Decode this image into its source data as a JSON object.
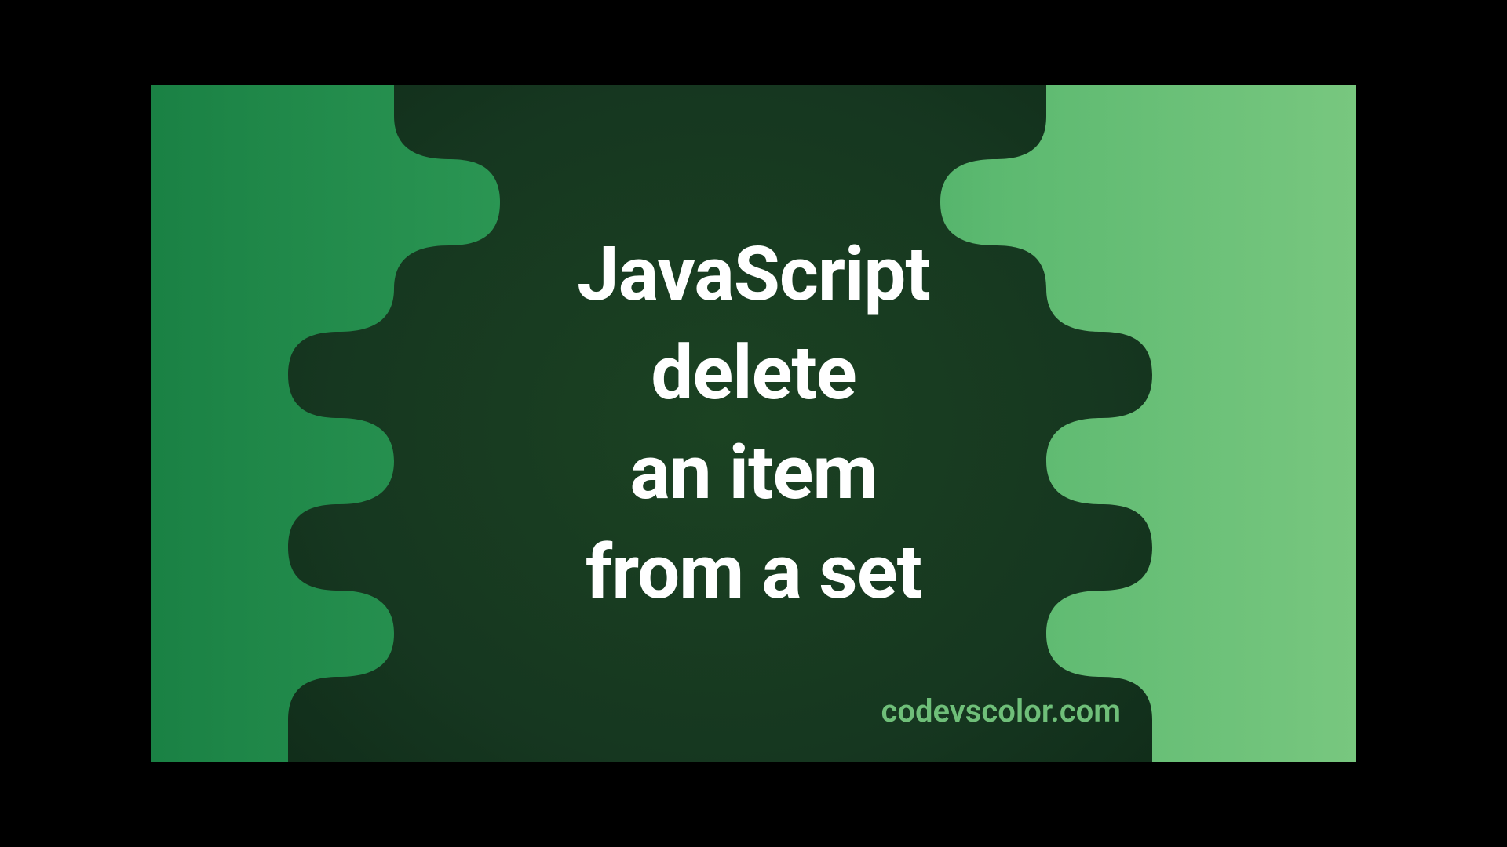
{
  "title": "JavaScript\ndelete\nan item\nfrom a set",
  "watermark": "codevscolor.com",
  "colors": {
    "blob_fill": "#15351c",
    "text": "#ffffff",
    "watermark": "#6fbf79",
    "bg_gradient_start": "#1a8144",
    "bg_gradient_end": "#78c77f"
  }
}
